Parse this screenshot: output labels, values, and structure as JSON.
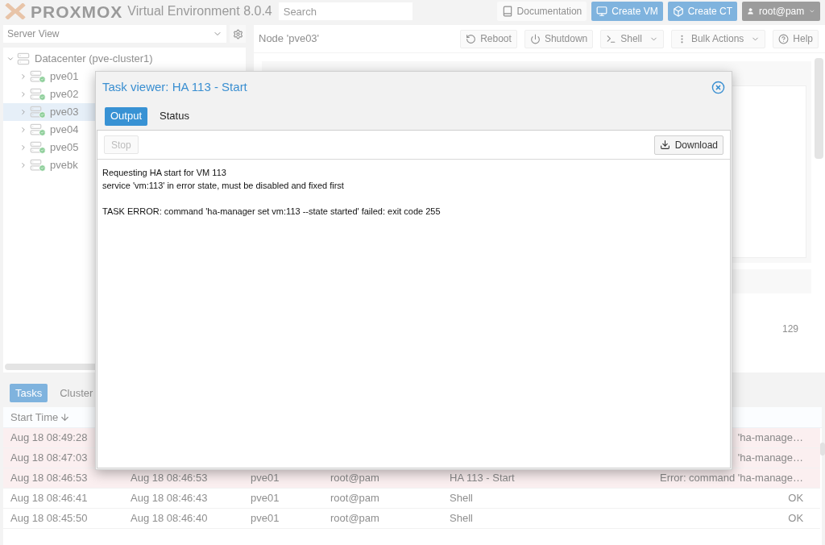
{
  "header": {
    "logo": "PROXMOX",
    "product": "Virtual Environment 8.0.4",
    "search": {
      "placeholder": "Search"
    },
    "buttons": [
      {
        "label": "Documentation",
        "kind": "doc",
        "primary": false
      },
      {
        "label": "Create VM",
        "kind": "vm",
        "primary": true
      },
      {
        "label": "Create CT",
        "kind": "ct",
        "primary": true
      }
    ],
    "user": "root@pam"
  },
  "view_select": {
    "value": "Server View"
  },
  "tree": {
    "label": "Datacenter (pve-cluster1)",
    "expanded": true,
    "children": [
      {
        "label": "pve01",
        "selected": false
      },
      {
        "label": "pve02",
        "selected": false
      },
      {
        "label": "pve03",
        "selected": true
      },
      {
        "label": "pve04",
        "selected": false
      },
      {
        "label": "pve05",
        "selected": false
      },
      {
        "label": "pvebk",
        "selected": false
      }
    ]
  },
  "node_toolbar": {
    "title": "Node 'pve03'",
    "buttons": [
      {
        "label": "Reboot",
        "kind": "reboot"
      },
      {
        "label": "Shutdown",
        "kind": "power"
      },
      {
        "label": "Shell",
        "kind": "shell"
      },
      {
        "label": "Bulk Actions",
        "kind": "bulk"
      },
      {
        "label": "Help",
        "kind": "help"
      }
    ]
  },
  "content_value": "129",
  "bottom": {
    "tabs": [
      {
        "label": "Tasks",
        "selected": true
      },
      {
        "label": "Cluster",
        "selected": false
      }
    ],
    "columns": [
      "Start Time"
    ],
    "rows": [
      {
        "error": true,
        "cells": [
          "Aug 18 08:49:28",
          "",
          "",
          "",
          "",
          "'ha-manage…"
        ]
      },
      {
        "error": true,
        "cells": [
          "Aug 18 08:47:03",
          "",
          "",
          "",
          "",
          "'ha-manage…"
        ]
      },
      {
        "error": true,
        "cells": [
          "Aug 18 08:46:53",
          "Aug 18 08:46:53",
          "pve01",
          "root@pam",
          "HA 113 - Start",
          "Error: command 'ha-manage…"
        ]
      },
      {
        "error": false,
        "cells": [
          "Aug 18 08:46:41",
          "Aug 18 08:46:43",
          "pve01",
          "root@pam",
          "Shell",
          "OK"
        ]
      },
      {
        "error": false,
        "cells": [
          "Aug 18 08:45:50",
          "Aug 18 08:46:40",
          "pve01",
          "root@pam",
          "Shell",
          "OK"
        ]
      }
    ]
  },
  "dialog": {
    "title": "Task viewer: HA 113 - Start",
    "tabs": [
      {
        "label": "Output",
        "selected": true
      },
      {
        "label": "Status",
        "selected": false
      }
    ],
    "stop": {
      "label": "Stop",
      "disabled": true
    },
    "download": "Download",
    "output": [
      [
        "Requesting HA start for VM 113",
        "service 'vm:113' in error state, must be disabled and fixed first"
      ],
      [
        "TASK ERROR: command 'ha-manager set vm:113 --state started' failed: exit code 255"
      ]
    ]
  }
}
